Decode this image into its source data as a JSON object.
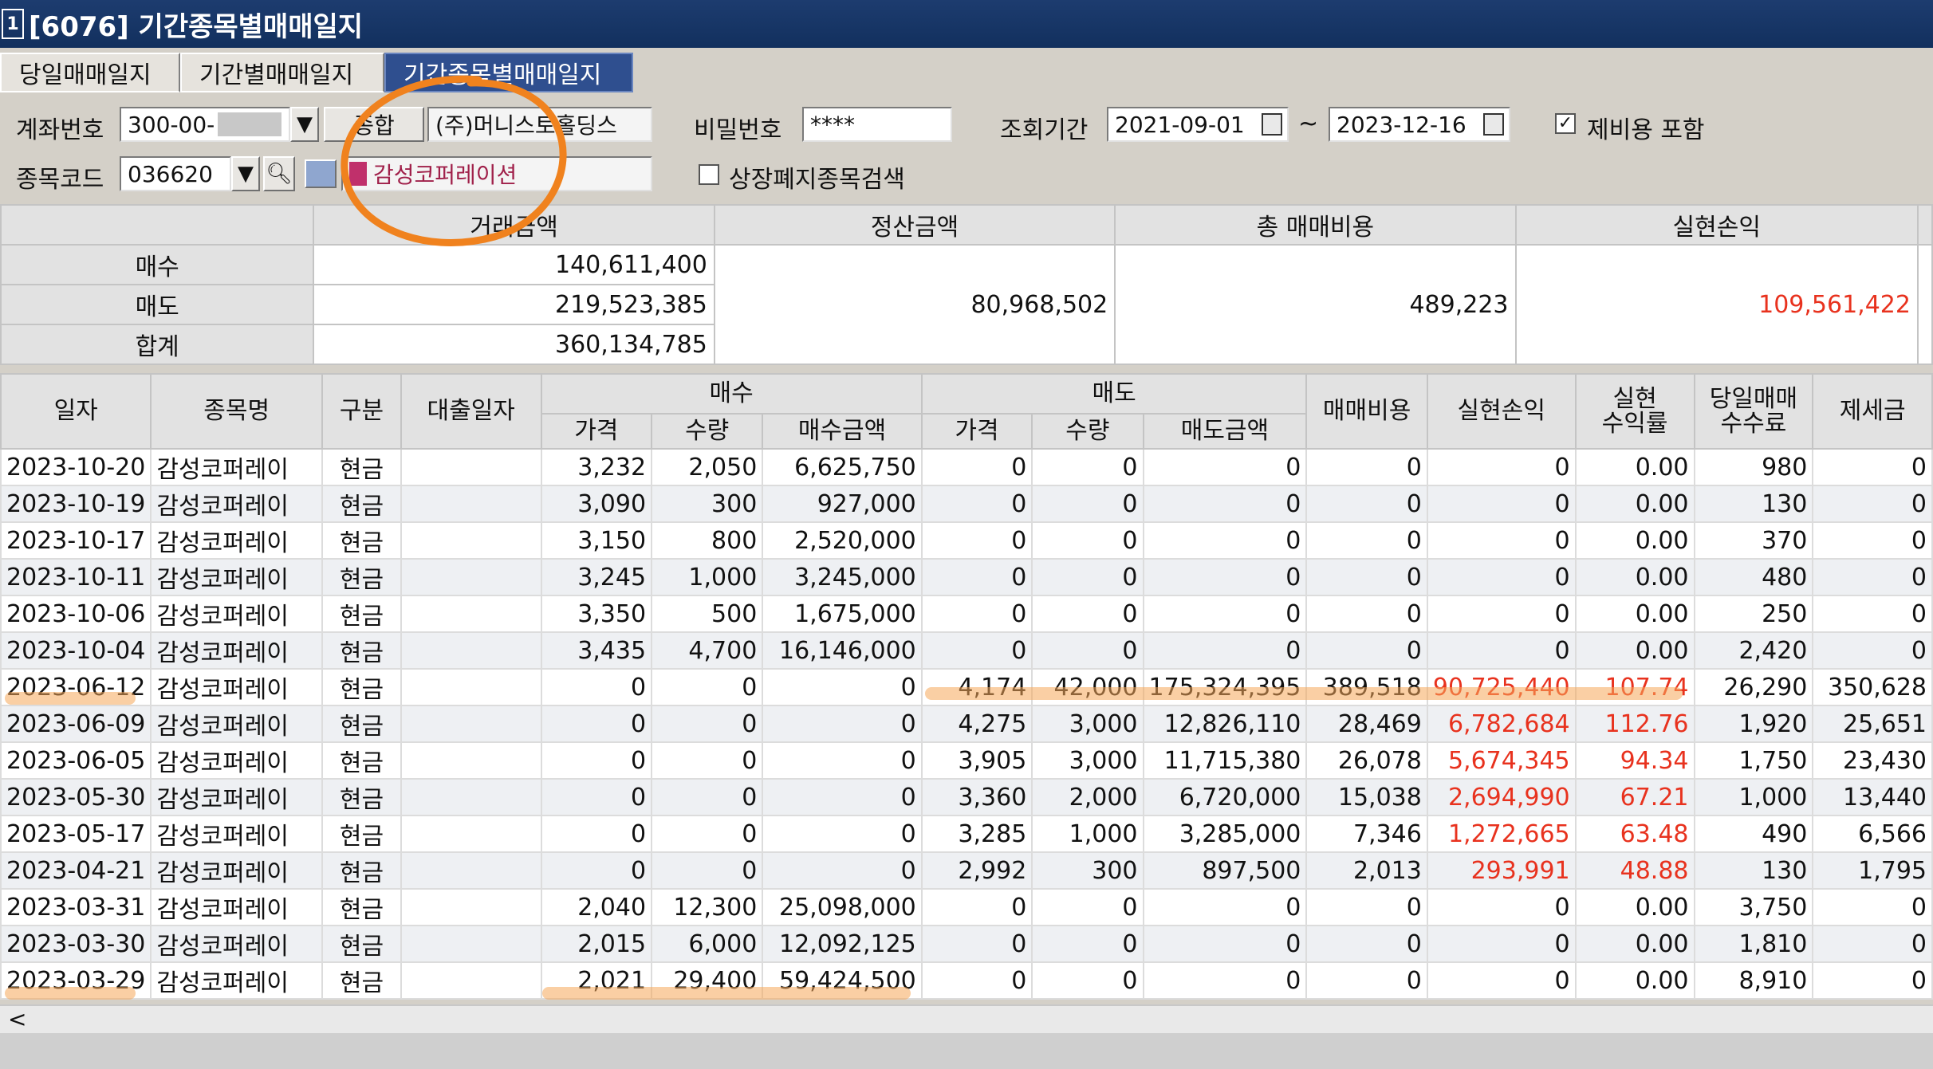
{
  "window": {
    "icon_text": "1",
    "title": "[6076] 기간종목별매매일지"
  },
  "tabs": [
    "당일매매일지",
    "기간별매매일지",
    "기간종목별매매일지"
  ],
  "form": {
    "account_label": "계좌번호",
    "account_value": "300-00-",
    "account_btn": "종합",
    "company_name": "(주)머니스토홀딩스",
    "password_label": "비밀번호",
    "password_value": "****",
    "period_label": "조회기간",
    "date_from": "2021-09-01",
    "tilde": "~",
    "date_to": "2023-12-16",
    "fee_check_label": "제비용 포함",
    "code_label": "종목코드",
    "code_value": "036620",
    "stock_name": "감성코퍼레이션",
    "delisted_label": "상장폐지종목검색"
  },
  "summary": {
    "headers": [
      "거래금액",
      "정산금액",
      "총 매매비용",
      "실현손익"
    ],
    "rows": [
      {
        "label": "매수",
        "trade": "140,611,400"
      },
      {
        "label": "매도",
        "trade": "219,523,385"
      },
      {
        "label": "합계",
        "trade": "360,134,785"
      }
    ],
    "settle": "80,968,502",
    "total_cost": "489,223",
    "realized": "109,561,422"
  },
  "grid": {
    "headers": {
      "date": "일자",
      "name": "종목명",
      "type": "구분",
      "loan": "대출일자",
      "buy": "매수",
      "sell": "매도",
      "price": "가격",
      "qty": "수량",
      "buy_amt": "매수금액",
      "sell_amt": "매도금액",
      "cost": "매매비용",
      "pnl": "실현손익",
      "rate_1": "실현",
      "rate_2": "수익률",
      "fee_1": "당일매매",
      "fee_2": "수수료",
      "tax": "제세금"
    },
    "rows": [
      [
        "2023-10-20",
        "감성코퍼레이",
        "현금",
        "",
        "3,232",
        "2,050",
        "6,625,750",
        "0",
        "0",
        "0",
        "0",
        "0",
        "0.00",
        "980",
        "0"
      ],
      [
        "2023-10-19",
        "감성코퍼레이",
        "현금",
        "",
        "3,090",
        "300",
        "927,000",
        "0",
        "0",
        "0",
        "0",
        "0",
        "0.00",
        "130",
        "0"
      ],
      [
        "2023-10-17",
        "감성코퍼레이",
        "현금",
        "",
        "3,150",
        "800",
        "2,520,000",
        "0",
        "0",
        "0",
        "0",
        "0",
        "0.00",
        "370",
        "0"
      ],
      [
        "2023-10-11",
        "감성코퍼레이",
        "현금",
        "",
        "3,245",
        "1,000",
        "3,245,000",
        "0",
        "0",
        "0",
        "0",
        "0",
        "0.00",
        "480",
        "0"
      ],
      [
        "2023-10-06",
        "감성코퍼레이",
        "현금",
        "",
        "3,350",
        "500",
        "1,675,000",
        "0",
        "0",
        "0",
        "0",
        "0",
        "0.00",
        "250",
        "0"
      ],
      [
        "2023-10-04",
        "감성코퍼레이",
        "현금",
        "",
        "3,435",
        "4,700",
        "16,146,000",
        "0",
        "0",
        "0",
        "0",
        "0",
        "0.00",
        "2,420",
        "0"
      ],
      [
        "2023-06-12",
        "감성코퍼레이",
        "현금",
        "",
        "0",
        "0",
        "0",
        "4,174",
        "42,000",
        "175,324,395",
        "389,518",
        "90,725,440",
        "107.74",
        "26,290",
        "350,628"
      ],
      [
        "2023-06-09",
        "감성코퍼레이",
        "현금",
        "",
        "0",
        "0",
        "0",
        "4,275",
        "3,000",
        "12,826,110",
        "28,469",
        "6,782,684",
        "112.76",
        "1,920",
        "25,651"
      ],
      [
        "2023-06-05",
        "감성코퍼레이",
        "현금",
        "",
        "0",
        "0",
        "0",
        "3,905",
        "3,000",
        "11,715,380",
        "26,078",
        "5,674,345",
        "94.34",
        "1,750",
        "23,430"
      ],
      [
        "2023-05-30",
        "감성코퍼레이",
        "현금",
        "",
        "0",
        "0",
        "0",
        "3,360",
        "2,000",
        "6,720,000",
        "15,038",
        "2,694,990",
        "67.21",
        "1,000",
        "13,440"
      ],
      [
        "2023-05-17",
        "감성코퍼레이",
        "현금",
        "",
        "0",
        "0",
        "0",
        "3,285",
        "1,000",
        "3,285,000",
        "7,346",
        "1,272,665",
        "63.48",
        "490",
        "6,566"
      ],
      [
        "2023-04-21",
        "감성코퍼레이",
        "현금",
        "",
        "0",
        "0",
        "0",
        "2,992",
        "300",
        "897,500",
        "2,013",
        "293,991",
        "48.88",
        "130",
        "1,795"
      ],
      [
        "2023-03-31",
        "감성코퍼레이",
        "현금",
        "",
        "2,040",
        "12,300",
        "25,098,000",
        "0",
        "0",
        "0",
        "0",
        "0",
        "0.00",
        "3,750",
        "0"
      ],
      [
        "2023-03-30",
        "감성코퍼레이",
        "현금",
        "",
        "2,015",
        "6,000",
        "12,092,125",
        "0",
        "0",
        "0",
        "0",
        "0",
        "0.00",
        "1,810",
        "0"
      ],
      [
        "2023-03-29",
        "감성코퍼레이",
        "현금",
        "",
        "2,021",
        "29,400",
        "59,424,500",
        "0",
        "0",
        "0",
        "0",
        "0",
        "0.00",
        "8,910",
        "0"
      ]
    ]
  },
  "colors": {
    "title_bg": "#12305e",
    "active_tab": "#2f4f8f",
    "profit_red": "#e8321e",
    "annotation_orange": "#f0821e"
  },
  "scroll_left": "<"
}
